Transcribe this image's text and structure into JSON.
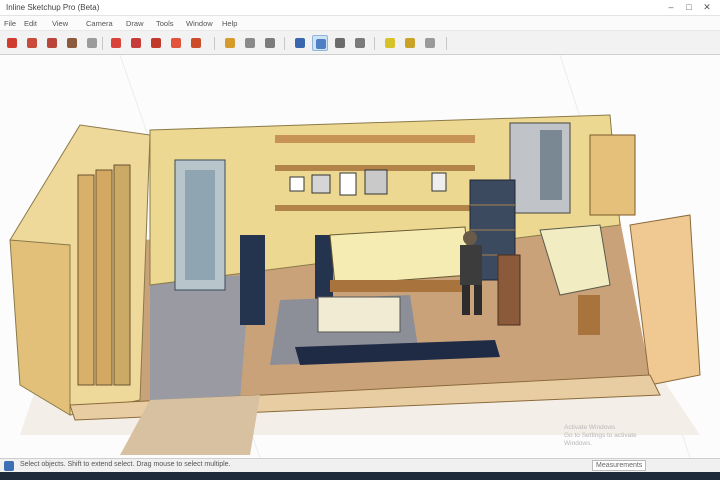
{
  "app": {
    "title": "Inline Sketchup Pro (Beta)",
    "window_controls": [
      "–",
      "□",
      "✕"
    ]
  },
  "menu": [
    "File",
    "Edit",
    "View",
    "Camera",
    "Draw",
    "Tools",
    "Window",
    "Help"
  ],
  "toolbar": {
    "tools": [
      {
        "icon": "pencil-icon",
        "color": "#d13a2e"
      },
      {
        "icon": "rectangle-icon",
        "color": "#c74a3a"
      },
      {
        "icon": "circle-icon",
        "color": "#b8463a"
      },
      {
        "icon": "polygon-icon",
        "color": "#8c5a3c"
      },
      {
        "icon": "arc-icon",
        "color": "#9b9b9b"
      },
      {
        "icon": "eraser-icon",
        "color": "#d9433a"
      },
      {
        "icon": "paint-bucket-icon",
        "color": "#c83b3b"
      },
      {
        "icon": "push-pull-icon",
        "color": "#c0392b"
      },
      {
        "icon": "move-icon",
        "color": "#e0543b"
      },
      {
        "icon": "rotate-icon",
        "color": "#cc4d2a"
      },
      {
        "icon": "tape-measure-icon",
        "color": "#d69c2b"
      },
      {
        "icon": "dimension-icon",
        "color": "#8a8a8a"
      },
      {
        "icon": "text-icon",
        "color": "#7c7c7c"
      },
      {
        "icon": "orbit-icon",
        "color": "#3a66b0"
      },
      {
        "icon": "pan-icon",
        "color": "#4d7fc4"
      },
      {
        "icon": "zoom-icon",
        "color": "#6b6b6b"
      },
      {
        "icon": "zoom-extents-icon",
        "color": "#7a7a7a"
      },
      {
        "icon": "section-plane-icon",
        "color": "#d8c22a"
      },
      {
        "icon": "walk-icon",
        "color": "#c9a227"
      },
      {
        "icon": "position-camera-icon",
        "color": "#9a9a9a"
      }
    ]
  },
  "status": {
    "message": "Select objects. Shift to extend select. Drag mouse to select multiple.",
    "measurements_label": "Measurements"
  },
  "watermark": [
    "Activate Windows",
    "Go to Settings to activate",
    "Windows."
  ]
}
